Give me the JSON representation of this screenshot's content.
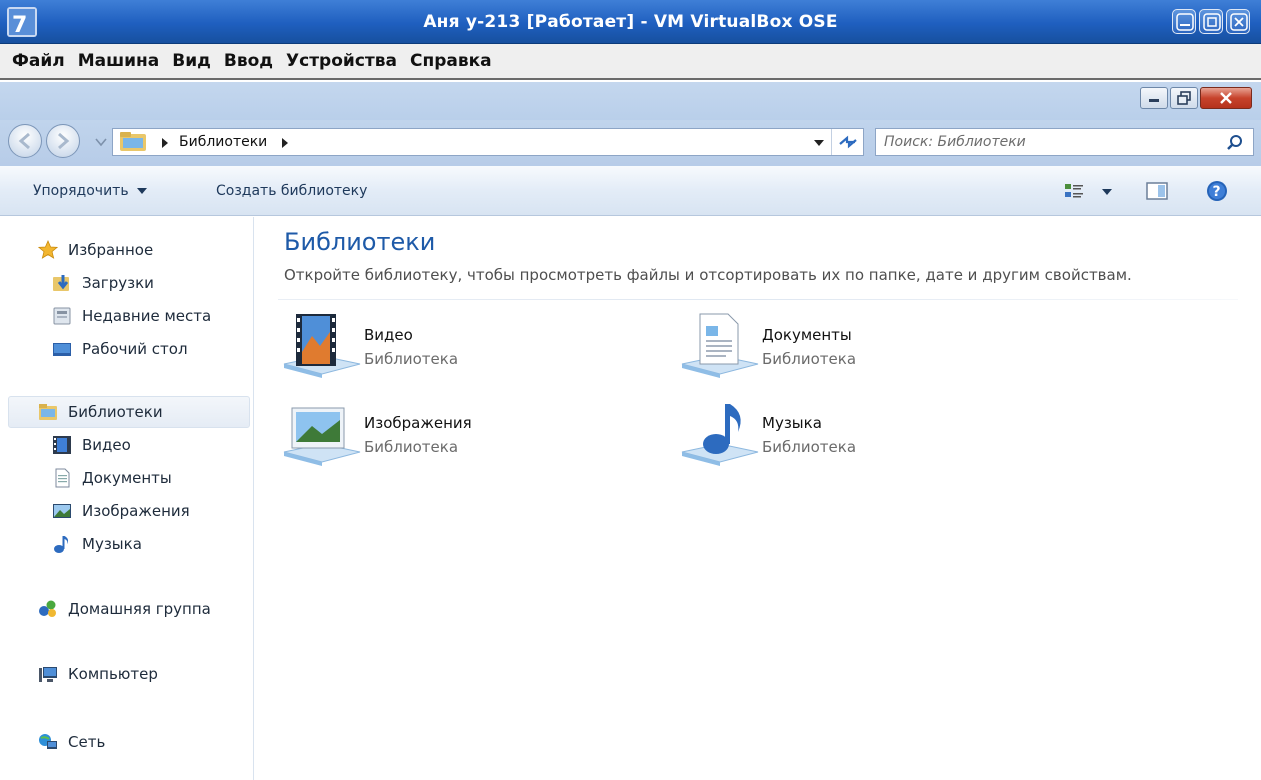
{
  "vbox": {
    "title": "Аня у-213 [Работает] - VM VirtualBox OSE",
    "menu": [
      "Файл",
      "Машина",
      "Вид",
      "Ввод",
      "Устройства",
      "Справка"
    ]
  },
  "explorer": {
    "breadcrumb": "Библиотеки",
    "search_placeholder": "Поиск: Библиотеки",
    "toolbar": {
      "organize": "Упорядочить",
      "create_library": "Создать библиотеку"
    },
    "nav": {
      "favorites": "Избранное",
      "downloads": "Загрузки",
      "recent": "Недавние места",
      "desktop": "Рабочий стол",
      "libraries": "Библиотеки",
      "video": "Видео",
      "documents": "Документы",
      "pictures": "Изображения",
      "music": "Музыка",
      "homegroup": "Домашняя группа",
      "computer": "Компьютер",
      "network": "Сеть"
    },
    "content": {
      "title": "Библиотеки",
      "subtitle": "Откройте библиотеку, чтобы просмотреть файлы и отсортировать их по папке, дате и другим свойствам.",
      "libraries": [
        {
          "name": "Видео",
          "type": "Библиотека",
          "icon": "video-library-icon"
        },
        {
          "name": "Документы",
          "type": "Библиотека",
          "icon": "documents-library-icon"
        },
        {
          "name": "Изображения",
          "type": "Библиотека",
          "icon": "pictures-library-icon"
        },
        {
          "name": "Музыка",
          "type": "Библиотека",
          "icon": "music-library-icon"
        }
      ]
    }
  }
}
